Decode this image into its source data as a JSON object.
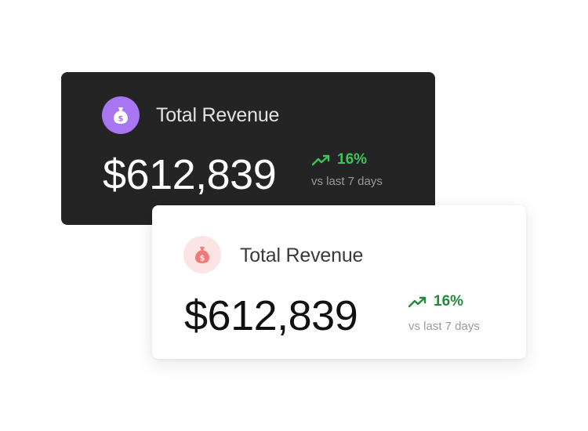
{
  "cards": [
    {
      "theme": "dark",
      "icon": "money-bag-icon",
      "accent": "#a876f0",
      "title": "Total Revenue",
      "amount": "$612,839",
      "change": "16%",
      "change_icon": "trend-up-icon",
      "change_color": "#3fc35a",
      "period": "vs last 7 days"
    },
    {
      "theme": "light",
      "icon": "money-bag-icon",
      "accent": "#f07a7a",
      "title": "Total Revenue",
      "amount": "$612,839",
      "change": "16%",
      "change_icon": "trend-up-icon",
      "change_color": "#1f8a3b",
      "period": "vs last 7 days"
    }
  ]
}
